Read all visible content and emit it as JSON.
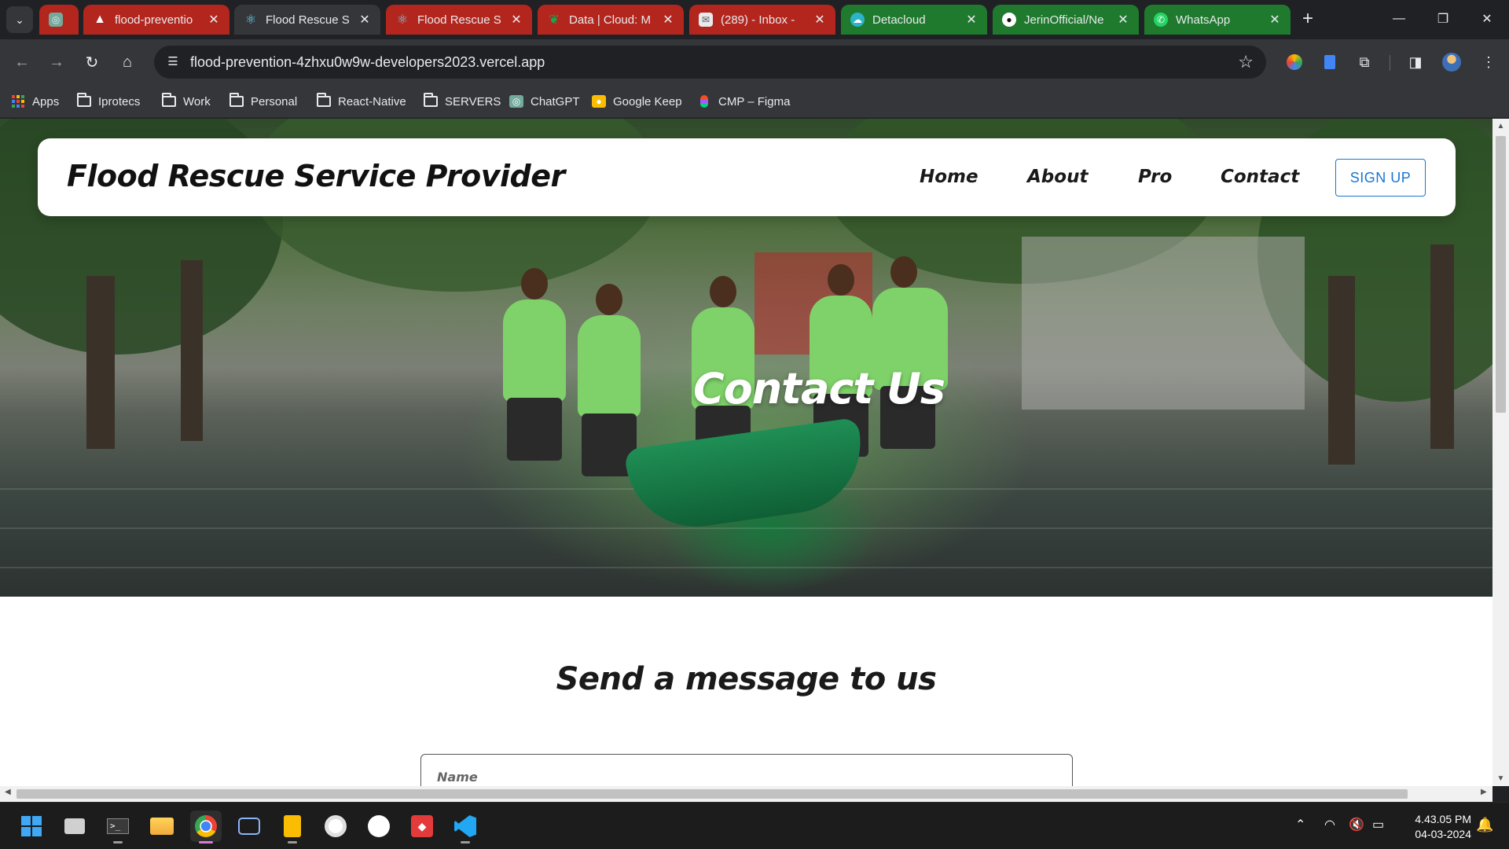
{
  "browser": {
    "tabs": [
      {
        "title": "",
        "icon": "chatgpt-icon",
        "style": "red",
        "active": false
      },
      {
        "title": "flood-preventio",
        "icon": "vercel-icon",
        "style": "red",
        "active": false
      },
      {
        "title": "Flood Rescue S",
        "icon": "react-icon",
        "style": "normal",
        "active": true
      },
      {
        "title": "Flood Rescue S",
        "icon": "react-icon",
        "style": "red",
        "active": false
      },
      {
        "title": "Data | Cloud: M",
        "icon": "mongodb-icon",
        "style": "red",
        "active": false
      },
      {
        "title": "(289) - Inbox - ",
        "icon": "mail-icon",
        "style": "red",
        "active": false
      },
      {
        "title": "Detacloud",
        "icon": "cloud-icon",
        "style": "green",
        "active": false
      },
      {
        "title": "JerinOfficial/Ne",
        "icon": "github-icon",
        "style": "green",
        "active": false
      },
      {
        "title": "WhatsApp",
        "icon": "whatsapp-icon",
        "style": "green",
        "active": false
      }
    ],
    "url": "flood-prevention-4zhxu0w9w-developers2023.vercel.app",
    "bookmarks": [
      {
        "label": "Apps",
        "icon": "apps-grid-icon"
      },
      {
        "label": "Iprotecs",
        "icon": "folder-icon"
      },
      {
        "label": "Work",
        "icon": "folder-icon"
      },
      {
        "label": "Personal",
        "icon": "folder-icon"
      },
      {
        "label": "React-Native",
        "icon": "folder-icon"
      },
      {
        "label": "SERVERS",
        "icon": "folder-icon"
      },
      {
        "label": "ChatGPT",
        "icon": "chatgpt-icon"
      },
      {
        "label": "Google Keep",
        "icon": "keep-icon"
      },
      {
        "label": "CMP – Figma",
        "icon": "figma-icon"
      }
    ]
  },
  "page": {
    "brand": "Flood Rescue Service Provider",
    "nav": [
      "Home",
      "About",
      "Pro",
      "Contact"
    ],
    "signup_label": "SIGN UP",
    "hero_title": "Contact Us",
    "form_title": "Send a message to us",
    "name_placeholder": "Name"
  },
  "taskbar": {
    "time": "4.43.05 PM",
    "date": "04-03-2024"
  },
  "colors": {
    "accent": "#1976d2",
    "tab_red": "#b3261e",
    "tab_green": "#1f7a2e"
  }
}
